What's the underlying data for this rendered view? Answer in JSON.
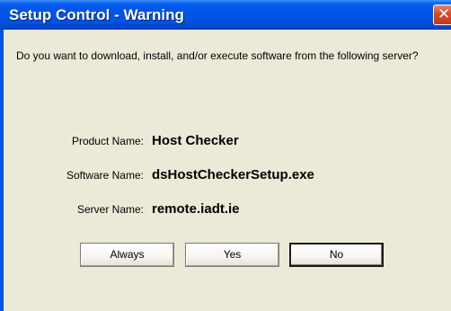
{
  "window": {
    "title": "Setup Control - Warning",
    "close_glyph": "✕"
  },
  "dialog": {
    "question": "Do you want to download, install, and/or execute software from the following server?",
    "fields": [
      {
        "label": "Product Name:",
        "value": "Host Checker"
      },
      {
        "label": "Software Name:",
        "value": "dsHostCheckerSetup.exe"
      },
      {
        "label": "Server Name:",
        "value": "remote.iadt.ie"
      }
    ]
  },
  "buttons": {
    "always_label": "Always",
    "yes_label": "Yes",
    "no_label": "No"
  },
  "colors": {
    "titlebar": "#0055e5",
    "client_background": "#ece9d8",
    "close_button": "#d6492a"
  }
}
